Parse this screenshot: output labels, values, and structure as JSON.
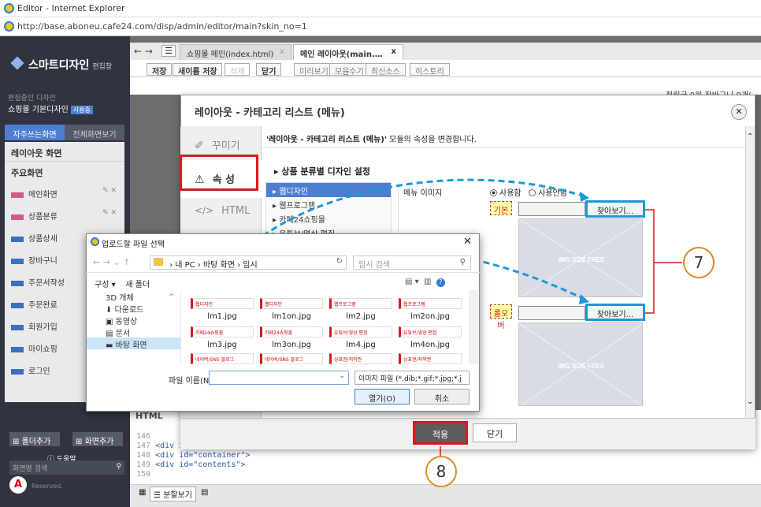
{
  "browser": {
    "title": "Editor - Internet Explorer",
    "url": "http://base.aboneu.cafe24.com/disp/admin/editor/main?skin_no=1"
  },
  "sidebar": {
    "brand": "스마트디자인",
    "brand_sub": "편집창",
    "editing_label": "편집중인 디자인",
    "shop_name": "쇼핑몰 기본디자인",
    "shop_badge": "사용중",
    "tab_frequent": "자주쓰는화면",
    "tab_all": "전체화면보기",
    "layout_header": "레이아웃 화면",
    "main_header": "주요화면",
    "items": [
      {
        "label": "메인화면"
      },
      {
        "label": "상품분류"
      },
      {
        "label": "상품상세"
      },
      {
        "label": "장바구니"
      },
      {
        "label": "주문서작성"
      },
      {
        "label": "주문완료"
      },
      {
        "label": "회원가입"
      },
      {
        "label": "마이쇼핑"
      },
      {
        "label": "로그인"
      }
    ],
    "add_folder": "폴더추가",
    "add_screen": "화면추가",
    "help": "도움말",
    "search_placeholder": "화면명 검색",
    "copyright": "Reserved."
  },
  "editor": {
    "tabs": [
      {
        "label": "쇼핑몰 메인(index.html)"
      },
      {
        "label": "메인 레이아웃(main.…"
      }
    ],
    "toolbar": {
      "save": "저장",
      "save_as": "새이름 저장",
      "delete": "삭제",
      "close": "닫기",
      "preview": "미리보기",
      "all_view": "모음수기",
      "latest": "최신소스",
      "history": "히스토리"
    },
    "top_info": "적립금 0원  장바구니 0개(",
    "code_section": "HTML",
    "code_lines": [
      {
        "n": "146",
        "text": ""
      },
      {
        "n": "147",
        "text": "<div id=\"wrap\">"
      },
      {
        "n": "148",
        "text": "    <div id=\"container\">"
      },
      {
        "n": "149",
        "text": "        <div id=\"contents\">"
      },
      {
        "n": "150",
        "text": ""
      }
    ],
    "split_view": "분할보기"
  },
  "modal": {
    "title": "레이아웃 - 카테고리 리스트 (메뉴)",
    "nav": [
      {
        "label": "꾸미기"
      },
      {
        "label": "속 성"
      },
      {
        "label": "HTML"
      }
    ],
    "description_module": "'레이아웃 - 카테고리 리스트 (메뉴)'",
    "description_rest": " 모듈의 속성을 변경합니다.",
    "section_title": "상품 분류별 디자인 설정",
    "tree": [
      {
        "label": "웹디자인"
      },
      {
        "label": "웹프로그램"
      },
      {
        "label": "카페24쇼핑몰"
      },
      {
        "label": "유튜브/영상 편집"
      }
    ],
    "menu_image_label": "메뉴 이미지",
    "radio_use": "사용함",
    "radio_nouse": "사용안함",
    "default_label": "기본",
    "rollover_label": "롤오버",
    "browse_label": "찾아보기...",
    "placeholder_text": "IMG SIZE FREE",
    "apply": "적용",
    "close": "닫기"
  },
  "file_dialog": {
    "title": "업로드할 파일 선택",
    "path": [
      "내 PC",
      "바탕 화면",
      "임시"
    ],
    "search_placeholder": "임시 검색",
    "organize": "구성 ▾",
    "new_folder": "새 폴더",
    "tree": [
      {
        "label": "3D 개체"
      },
      {
        "label": "다운로드"
      },
      {
        "label": "동영상"
      },
      {
        "label": "문서"
      },
      {
        "label": "바탕 화면"
      }
    ],
    "files": [
      {
        "name": "lm1.jpg",
        "thumb": "웹디자인"
      },
      {
        "name": "lm1on.jpg",
        "thumb": "웹디자인"
      },
      {
        "name": "lm2.jpg",
        "thumb": "웹프로그램"
      },
      {
        "name": "lm2on.jpg",
        "thumb": "웹프로그램"
      },
      {
        "name": "lm3.jpg",
        "thumb": "카페24쇼핑몰"
      },
      {
        "name": "lm3on.jpg",
        "thumb": "카페24쇼핑몰"
      },
      {
        "name": "lm4.jpg",
        "thumb": "유튜브/영상 편집"
      },
      {
        "name": "lm4on.jpg",
        "thumb": "유튜브/영상 편집"
      },
      {
        "name": "",
        "thumb": "네이버/SNS 블로그"
      },
      {
        "name": "",
        "thumb": "네이버/SNS 블로그"
      },
      {
        "name": "",
        "thumb": "상표권/저작권"
      },
      {
        "name": "",
        "thumb": "상표권/저작권"
      }
    ],
    "filename_label": "파일 이름(N):",
    "filetype": "이미지 파일 (*.dib;*.gif;*.jpg;*.j",
    "open": "열기(O)",
    "cancel": "취소"
  },
  "annotations": {
    "step7": "7",
    "step8": "8"
  }
}
